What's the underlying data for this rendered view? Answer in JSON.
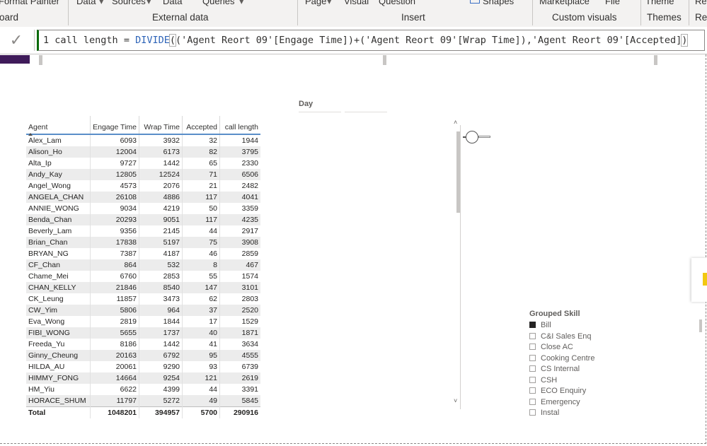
{
  "ribbon": {
    "top_items": {
      "format_painter": "Format Painter",
      "data": "Data",
      "sources": "Sources",
      "data2": "Data",
      "queries": "Queries",
      "page": "Page",
      "visual": "Visual",
      "question": "Question",
      "shapes": "Shapes",
      "marketplace": "Marketplace",
      "file": "File",
      "theme": "Theme",
      "re": "Re"
    },
    "groups": {
      "clipboard": "oard",
      "external_data": "External data",
      "insert": "Insert",
      "custom_visuals": "Custom visuals",
      "themes": "Themes",
      "re": "Re"
    }
  },
  "formula_bar": {
    "check_icon": "✓",
    "line_number": "1",
    "measure_name": "call length",
    "equals": " = ",
    "function": "DIVIDE",
    "open_paren": "(",
    "args": "('Agent Reort 09'[Engage Time])+('Agent Reort 09'[Wrap Time]),'Agent Reort 09'[Accepted]",
    "close_paren": ")"
  },
  "table": {
    "columns": [
      "Agent",
      "Engage Time",
      "Wrap Time",
      "Accepted",
      "call length"
    ],
    "rows": [
      [
        "Alex_Lam",
        "6093",
        "3932",
        "32",
        "1944"
      ],
      [
        "Alison_Ho",
        "12004",
        "6173",
        "82",
        "3795"
      ],
      [
        "Alta_Ip",
        "9727",
        "1442",
        "65",
        "2330"
      ],
      [
        "Andy_Kay",
        "12805",
        "12524",
        "71",
        "6506"
      ],
      [
        "Angel_Wong",
        "4573",
        "2076",
        "21",
        "2482"
      ],
      [
        "ANGELA_CHAN",
        "26108",
        "4886",
        "117",
        "4041"
      ],
      [
        "ANNIE_WONG",
        "9034",
        "4219",
        "50",
        "3359"
      ],
      [
        "Benda_Chan",
        "20293",
        "9051",
        "117",
        "4235"
      ],
      [
        "Beverly_Lam",
        "9356",
        "2145",
        "44",
        "2917"
      ],
      [
        "Brian_Chan",
        "17838",
        "5197",
        "75",
        "3908"
      ],
      [
        "BRYAN_NG",
        "7387",
        "4187",
        "46",
        "2859"
      ],
      [
        "CF_Chan",
        "864",
        "532",
        "8",
        "467"
      ],
      [
        "Chame_Mei",
        "6760",
        "2853",
        "55",
        "1574"
      ],
      [
        "CHAN_KELLY",
        "21846",
        "8540",
        "147",
        "3101"
      ],
      [
        "CK_Leung",
        "11857",
        "3473",
        "62",
        "2803"
      ],
      [
        "CW_Yim",
        "5806",
        "964",
        "37",
        "2520"
      ],
      [
        "Eva_Wong",
        "2819",
        "1844",
        "17",
        "1529"
      ],
      [
        "FIBI_WONG",
        "5655",
        "1737",
        "40",
        "1871"
      ],
      [
        "Freeda_Yu",
        "8186",
        "1442",
        "41",
        "3634"
      ],
      [
        "Ginny_Cheung",
        "20163",
        "6792",
        "95",
        "4555"
      ],
      [
        "HILDA_AU",
        "20061",
        "9290",
        "93",
        "6739"
      ],
      [
        "HIMMY_FONG",
        "14664",
        "9254",
        "121",
        "2619"
      ],
      [
        "HM_Yiu",
        "6622",
        "4399",
        "44",
        "3391"
      ],
      [
        "HORACE_SHUM",
        "11797",
        "5272",
        "49",
        "5845"
      ]
    ],
    "total": [
      "Total",
      "1048201",
      "394957",
      "5700",
      "290916"
    ]
  },
  "day_slicer": {
    "title": "Day"
  },
  "grouped_skill_slicer": {
    "title": "Grouped Skill",
    "items": [
      {
        "label": "Bill",
        "checked": true
      },
      {
        "label": "C&I Sales Enq",
        "checked": false
      },
      {
        "label": "Close AC",
        "checked": false
      },
      {
        "label": "Cooking Centre",
        "checked": false
      },
      {
        "label": "CS Internal",
        "checked": false
      },
      {
        "label": "CSH",
        "checked": false
      },
      {
        "label": "ECO Enquiry",
        "checked": false
      },
      {
        "label": "Emergency",
        "checked": false
      },
      {
        "label": "Instal",
        "checked": false
      }
    ]
  },
  "colors": {
    "accent_blue": "#5a8ec9",
    "dark_purple": "#3f1b5a",
    "formula_green": "#0b6a0b"
  }
}
